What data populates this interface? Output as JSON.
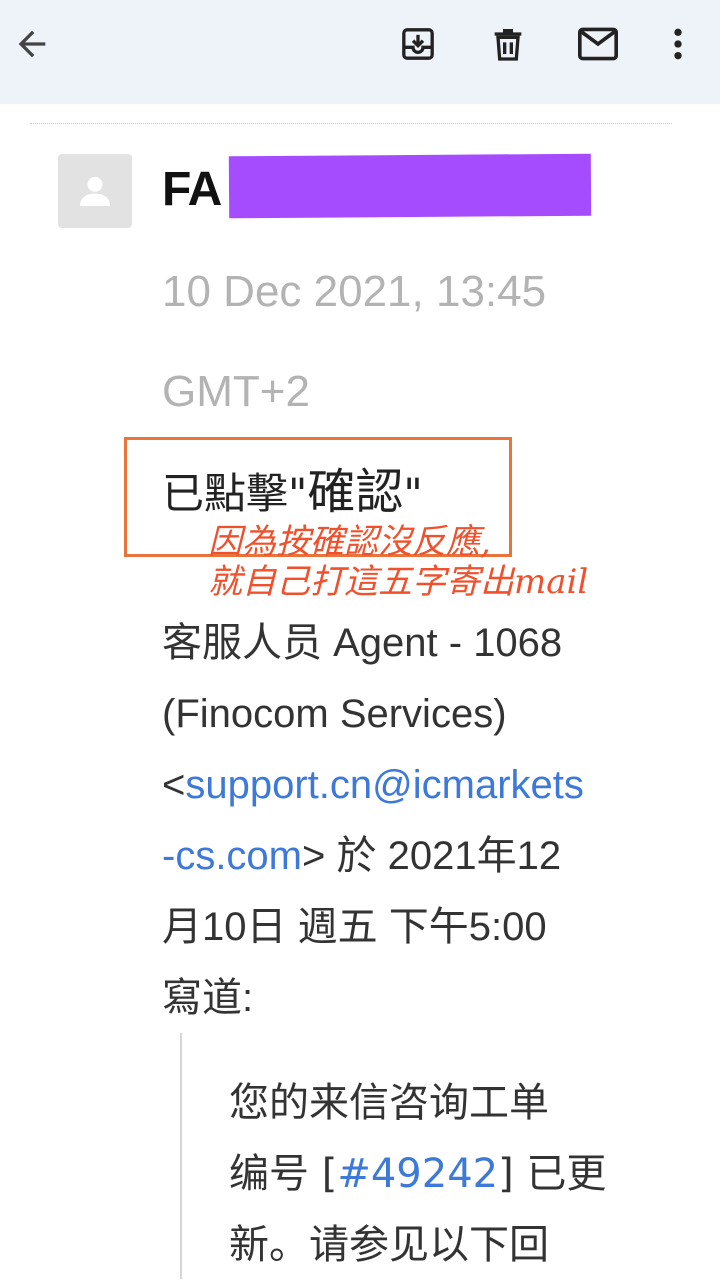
{
  "toolbar": {
    "back": "arrow-left-icon",
    "archive": "archive-icon",
    "delete": "trash-icon",
    "mark_unread": "mail-icon",
    "more": "more-vert-icon"
  },
  "message": {
    "sender_visible": "FA",
    "date": "10 Dec 2021, 13:45 GMT+2",
    "reply_prefix": "已點擊\"",
    "reply_word": "確認",
    "reply_suffix": "\"",
    "annotation_line1": "因為按確認沒反應,",
    "annotation_line2": "就自己打這五字寄出mail",
    "quote_header": {
      "line1": "客服人员 Agent - 1068",
      "line2": "(Finocom Services)",
      "lt": "<",
      "email_part1": "support.cn@icmarkets",
      "email_part2": "-cs.com",
      "gt_rest": "> 於 2021年12",
      "line5": "月10日 週五 下午5:00",
      "line6": "寫道:"
    },
    "quoted": {
      "line1": "您的来信咨询工单",
      "line2_pre": "编号 [",
      "ticket": "#49242",
      "line2_post": "] 已更",
      "line3": "新。请参见以下回"
    }
  },
  "colors": {
    "appbar_bg": "#eef2f9",
    "link": "#3d79d8",
    "annotation": "#f0502c",
    "redaction": "#a54cff"
  }
}
